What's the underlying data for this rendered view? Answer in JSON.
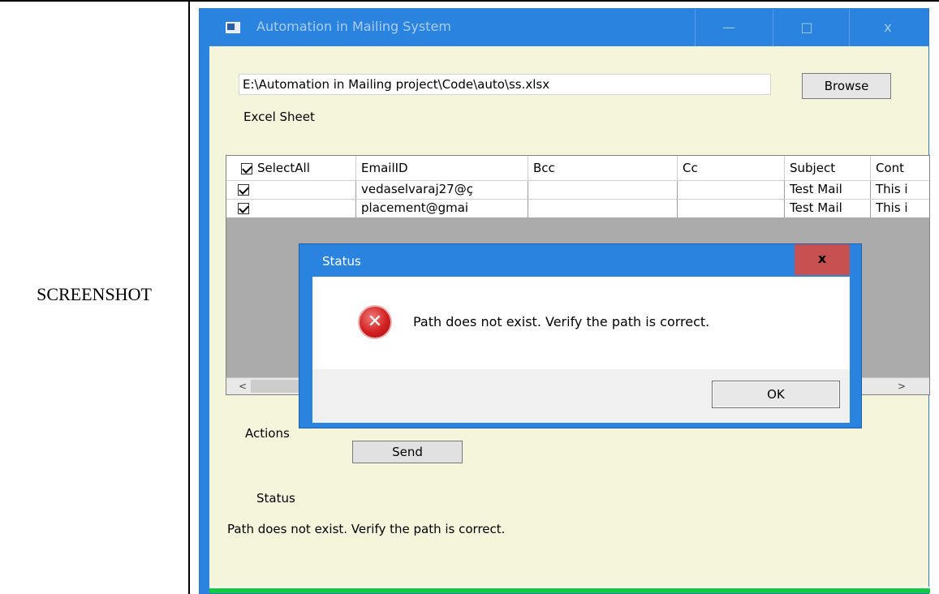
{
  "document": {
    "row_label": "SCREENSHOT"
  },
  "window": {
    "title": "Automation in Mailing System",
    "minimize_glyph": "—",
    "maximize_glyph": "□",
    "close_glyph": "x"
  },
  "file_picker": {
    "path_value": "E:\\Automation in Mailing project\\Code\\auto\\ss.xlsx",
    "browse_label": "Browse",
    "section_label": "Excel Sheet"
  },
  "grid": {
    "headers": [
      "SelectAll",
      "EmailID",
      "Bcc",
      "Cc",
      "Subject",
      "Cont"
    ],
    "rows": [
      {
        "checked": true,
        "email": "vedaselvaraj27@ç",
        "bcc": "",
        "cc": "",
        "subject": "Test Mail",
        "content": "This i"
      },
      {
        "checked": true,
        "email": "placement@gmai",
        "bcc": "",
        "cc": "",
        "subject": "Test Mail",
        "content": "This i"
      }
    ],
    "scroll_left": "<",
    "scroll_right": ">"
  },
  "actions": {
    "label": "Actions",
    "send_label": "Send"
  },
  "status": {
    "label": "Status",
    "message": "Path does not exist. Verify the path is correct.",
    "progress_fraction": 1.0
  },
  "dialog": {
    "title": "Status",
    "close_glyph": "x",
    "message": "Path does not exist. Verify the path is correct.",
    "ok_label": "OK"
  },
  "colors": {
    "titlebar": "#2b83e0",
    "window_bg": "#f5f5dc",
    "dialog_close": "#c75050",
    "progress": "#0fcc3c"
  }
}
